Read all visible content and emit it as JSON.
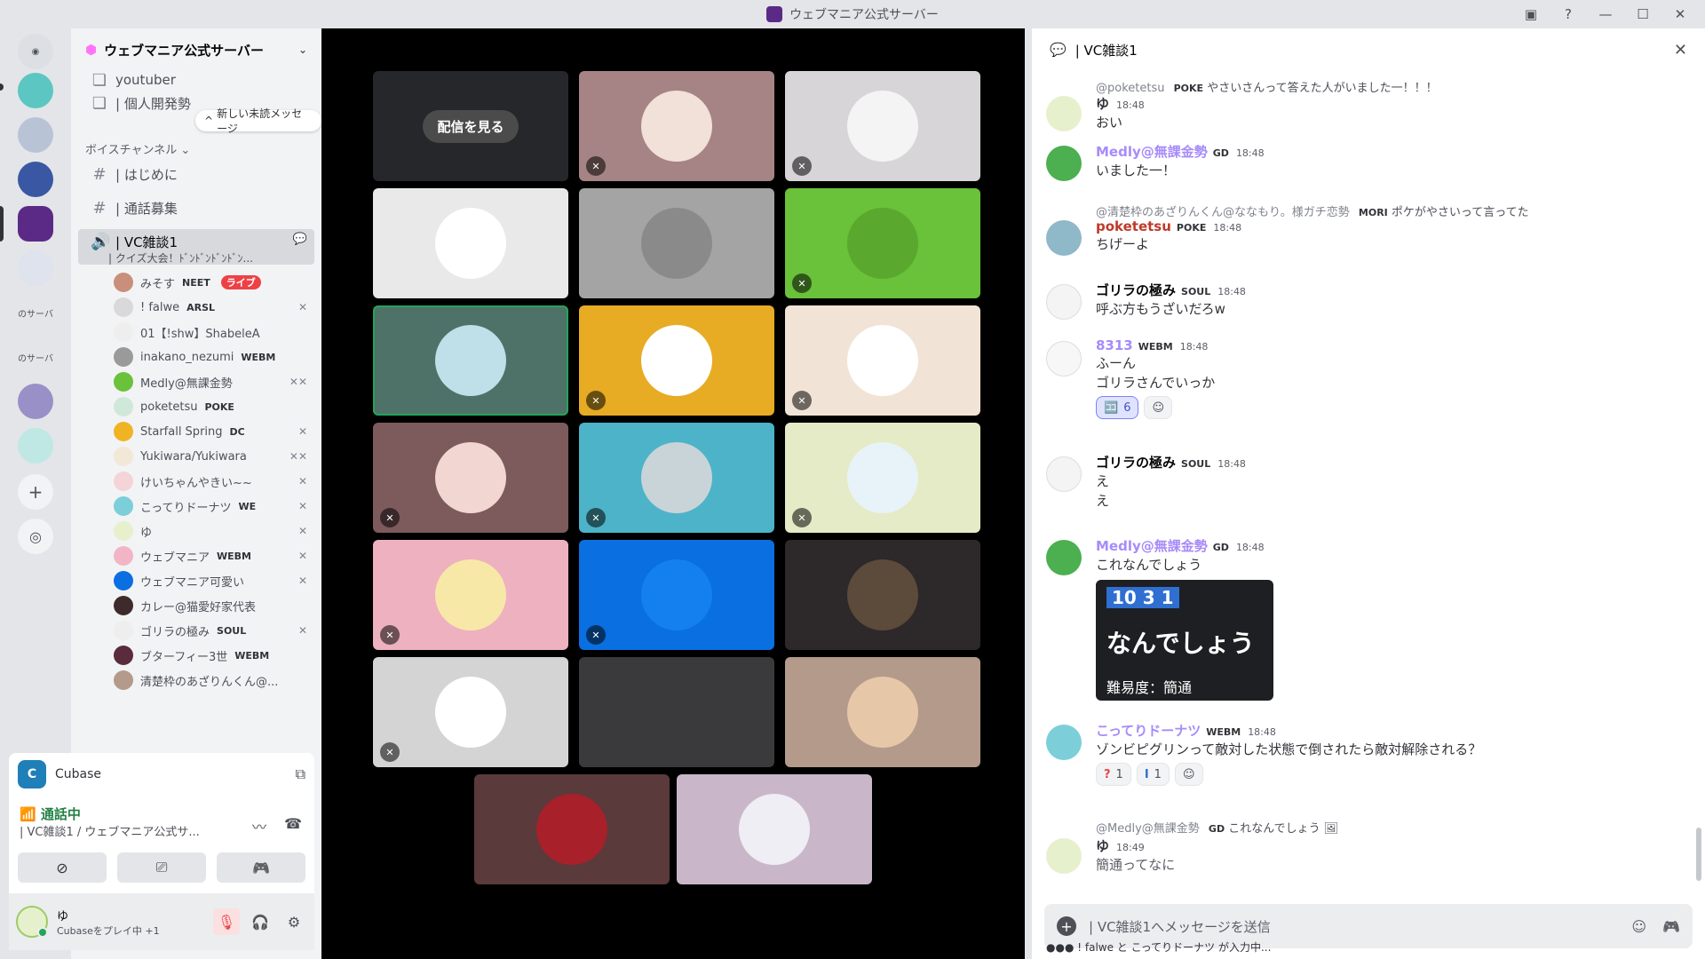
{
  "window": {
    "title": "ウェブマニア公式サーバー"
  },
  "colors": {
    "accent": "#5865f2",
    "online": "#23a55a",
    "danger": "#ed4245",
    "live": "#ed4245"
  },
  "server": {
    "name": "ウェブマニア公式サーバー",
    "new_unread": "新しい未読メッセージ",
    "channels_top": [
      {
        "name": "youtuber"
      },
      {
        "name": "| 個人開発勢"
      }
    ],
    "voice_category": "ボイスチャンネル",
    "text_channels": [
      {
        "name": "| はじめに"
      },
      {
        "name": "| 通話募集"
      }
    ],
    "active_vc": {
      "name": "| VC雑談1",
      "status": "| クイズ大会！ﾄﾞﾝﾄﾞﾝﾄﾞﾝﾄﾞﾝ..."
    },
    "voice_users": [
      {
        "name": "みそす",
        "tag": "NEET",
        "live": "ライブ"
      },
      {
        "name": "! falwe",
        "tag": "ARSL"
      },
      {
        "name": "01【!shw】ShabeleA",
        "tag": ""
      },
      {
        "name": "inakano_nezumi",
        "tag": "WEBM"
      },
      {
        "name": "Medly@無課金勢",
        "tag": ""
      },
      {
        "name": "poketetsu",
        "tag": "POKE"
      },
      {
        "name": "Starfall Spring",
        "tag": "DC"
      },
      {
        "name": "Yukiwara/Yukiwara",
        "tag": ""
      },
      {
        "name": "けいちゃんやきい~~",
        "tag": ""
      },
      {
        "name": "こってりドーナツ",
        "tag": "WE"
      },
      {
        "name": "ゆ",
        "tag": ""
      },
      {
        "name": "ウェブマニア",
        "tag": "WEBM"
      },
      {
        "name": "ウェブマニア可愛い",
        "tag": ""
      },
      {
        "name": "カレー@猫愛好家代表",
        "tag": ""
      },
      {
        "name": "ゴリラの極み",
        "tag": "SOUL"
      },
      {
        "name": "ブターフィー3世",
        "tag": "WEBM"
      },
      {
        "name": "清楚枠のあざりんくん@...",
        "tag": ""
      }
    ]
  },
  "rail": {
    "label_1": "のサーバ",
    "label_2": "のサーバ"
  },
  "activity": {
    "app": "Cubase"
  },
  "voice_panel": {
    "status": "通話中",
    "channel": "| VC雑談1 / ウェブマニア公式サ..."
  },
  "user_panel": {
    "name": "ゆ",
    "activity": "Cubaseをプレイ中 +1"
  },
  "stage": {
    "watch_label": "配信を見る"
  },
  "chat": {
    "header": "| VC雑談1",
    "placeholder": "| VC雑談1へメッセージを送信",
    "typing": "! falwe と こってりドーナツ が入力中...",
    "messages": [
      {
        "reply_name": "@poketetsu",
        "reply_badge": "POKE",
        "reply_text": "やさいさんって答えた人がいました一！！！",
        "author": "ゆ",
        "time": "18:48",
        "lines": [
          "おい"
        ],
        "author_color": "#313338"
      },
      {
        "author": "Medly@無課金勢",
        "badge": "GD",
        "time": "18:48",
        "lines": [
          "いました一！"
        ],
        "author_color": "#a78bfa"
      },
      {
        "reply_name": "@清楚枠のあざりんくん@ななもり。様ガチ恋勢",
        "reply_badge": "MORI",
        "reply_text": "ポケがやさいって言ってた",
        "author": "poketetsu",
        "badge": "POKE",
        "time": "18:48",
        "lines": [
          "ちげーよ"
        ],
        "author_color": "#c0392b"
      },
      {
        "author": "ゴリラの極み",
        "badge": "SOUL",
        "time": "18:48",
        "lines": [
          "呼ぶ方もうざいだろw"
        ],
        "author_color": "#060607"
      },
      {
        "author": "8313",
        "badge": "WEBM",
        "time": "18:48",
        "lines": [
          "ふーん",
          "ゴリラさんでいっか"
        ],
        "reaction_count": "6",
        "author_color": "#a78bfa"
      },
      {
        "author": "ゴリラの極み",
        "badge": "SOUL",
        "time": "18:48",
        "lines": [
          "え",
          "え"
        ],
        "author_color": "#060607"
      },
      {
        "author": "Medly@無課金勢",
        "badge": "GD",
        "time": "18:48",
        "lines": [
          "これなんでしょう"
        ],
        "author_color": "#a78bfa"
      },
      {
        "author": "こってりドーナツ",
        "badge": "WEBM",
        "time": "18:48",
        "lines": [
          "ゾンビピグリンって敵対した状態で倒されたら敵対解除される？"
        ],
        "react_1": "1",
        "react_2": "1",
        "author_color": "#a78bfa"
      },
      {
        "reply_name": "@Medly@無課金勢",
        "reply_badge": "GD",
        "reply_text": "これなんでしょう",
        "author": "ゆ",
        "time": "18:49",
        "lines": [
          "簡通ってなに"
        ],
        "author_color": "#313338"
      }
    ],
    "quiz": {
      "num": "10 3 1",
      "title": "なんでしょう",
      "diff": "難易度：簡通"
    }
  }
}
